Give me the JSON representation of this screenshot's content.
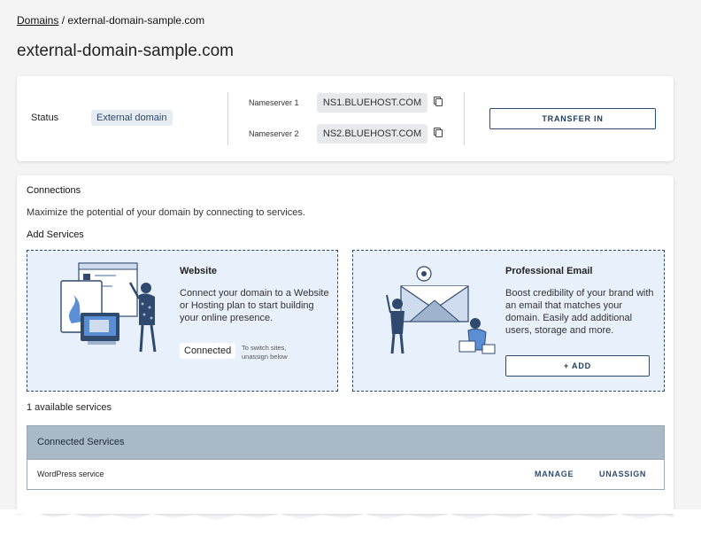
{
  "breadcrumb": {
    "root": "Domains",
    "separator": " / ",
    "current": "external-domain-sample.com"
  },
  "page_title": "external-domain-sample.com",
  "status": {
    "label": "Status",
    "badge": "External domain",
    "nameservers": [
      {
        "label": "Nameserver 1",
        "value": "NS1.BLUEHOST.COM"
      },
      {
        "label": "Nameserver 2",
        "value": "NS2.BLUEHOST.COM"
      }
    ],
    "transfer_label": "TRANSFER IN"
  },
  "connections": {
    "title": "Connections",
    "description": "Maximize the potential of your domain by connecting to services.",
    "add_services_title": "Add Services",
    "website": {
      "title": "Website",
      "description": "Connect your domain to a Website or Hosting plan to start building your online presence.",
      "connected_label": "Connected",
      "switch_note": "To switch sites, unassign below"
    },
    "email": {
      "title": "Professional Email",
      "description": "Boost credibility of your brand with an email that matches your domain. Easily add additional users, storage and more.",
      "add_label": "+ ADD"
    },
    "available_text": "1 available services",
    "table": {
      "header": "Connected Services",
      "rows": [
        {
          "name": "WordPress service",
          "manage": "MANAGE",
          "unassign": "UNASSIGN"
        }
      ]
    }
  },
  "colors": {
    "accent": "#2d4b6e",
    "service_box_bg": "#e8f0fb",
    "table_header_bg": "#a9b9c8",
    "badge_bg": "#e5ecf2"
  },
  "icons": [
    "copy-icon",
    "website-illustration",
    "email-illustration"
  ]
}
